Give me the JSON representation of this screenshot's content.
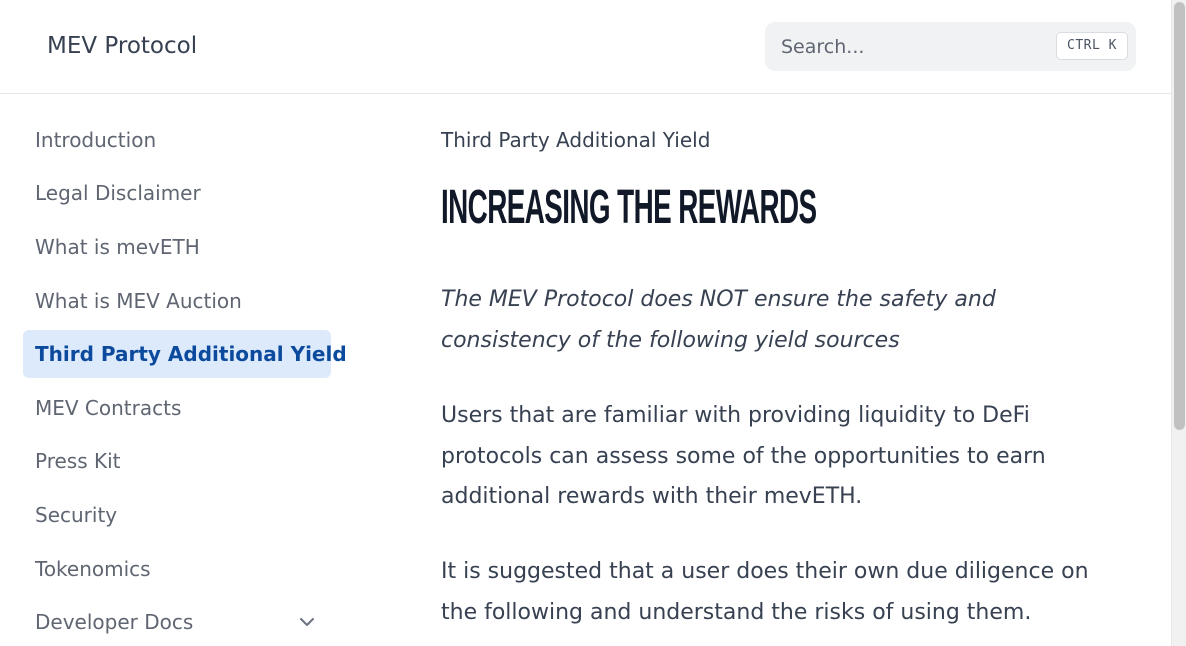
{
  "header": {
    "brand": "MEV Protocol",
    "search": {
      "placeholder": "Search...",
      "shortcut": "CTRL K"
    }
  },
  "sidebar": {
    "items": [
      {
        "label": "Introduction",
        "active": false
      },
      {
        "label": "Legal Disclaimer",
        "active": false
      },
      {
        "label": "What is mevETH",
        "active": false
      },
      {
        "label": "What is MEV Auction",
        "active": false
      },
      {
        "label": "Third Party Additional Yield",
        "active": true
      },
      {
        "label": "MEV Contracts",
        "active": false
      },
      {
        "label": "Press Kit",
        "active": false
      },
      {
        "label": "Security",
        "active": false
      },
      {
        "label": "Tokenomics",
        "active": false
      },
      {
        "label": "Developer Docs",
        "active": false,
        "expandable": true,
        "icon": "chevron-down-icon"
      }
    ]
  },
  "main": {
    "breadcrumb": "Third Party Additional Yield",
    "title": "INCREASING THE REWARDS",
    "disclaimer": "The MEV Protocol does NOT ensure the safety and consistency of the following yield sources",
    "paragraphs": [
      "Users that are familiar with providing liquidity to DeFi protocols can assess some of the opportunities to earn additional rewards with their mevETH.",
      "It is suggested that a user does their own due diligence on the following and understand the risks of using them."
    ]
  },
  "colors": {
    "active_bg": "#dceafb",
    "active_text": "#0c4a9e",
    "title": "#111827",
    "body_text": "#374151",
    "nav_text": "#5f6672"
  }
}
